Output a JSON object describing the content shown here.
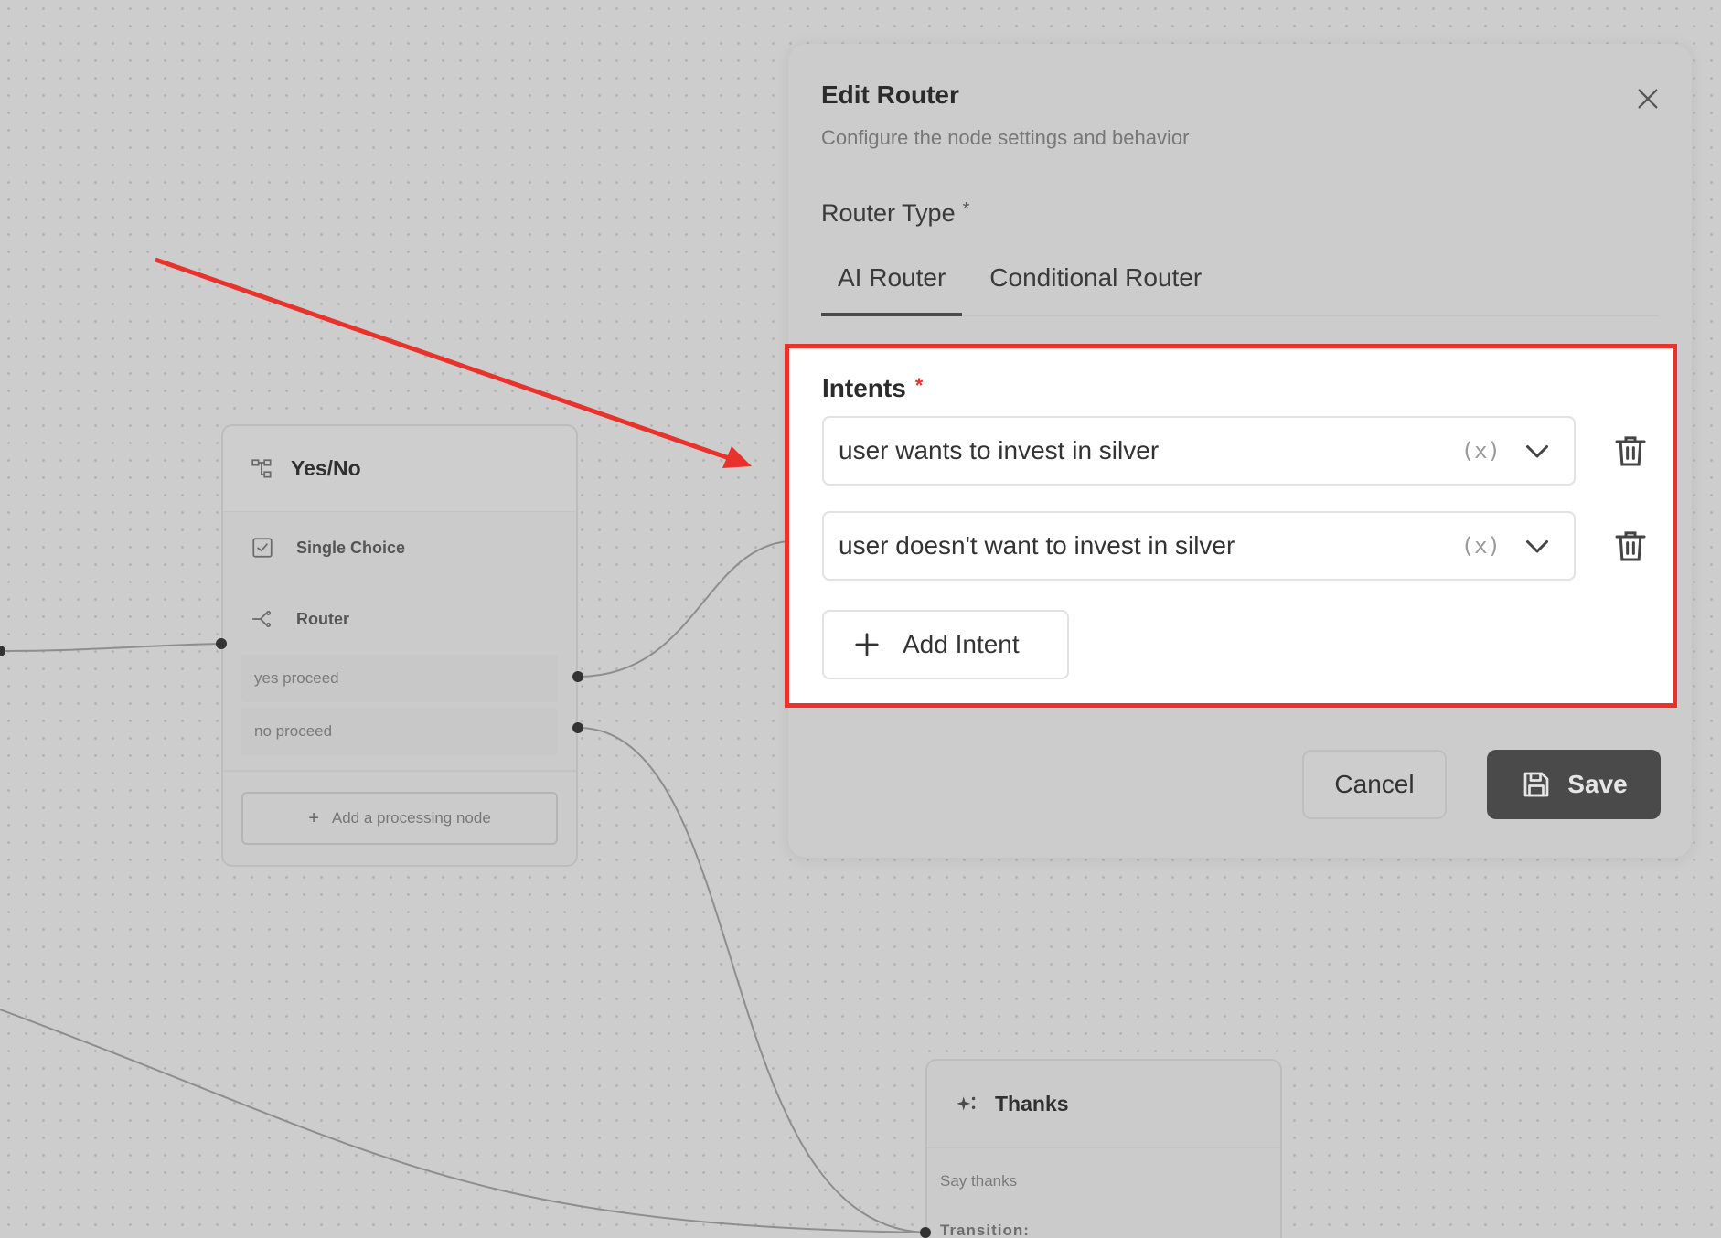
{
  "dialog": {
    "title": "Edit Router",
    "subtitle": "Configure the node settings and behavior",
    "router_type_label": "Router Type",
    "required_mark": "*",
    "tabs": [
      {
        "label": "AI Router",
        "active": true
      },
      {
        "label": "Conditional Router",
        "active": false
      }
    ],
    "intents_label": "Intents",
    "intents": [
      {
        "value": "user wants to invest in silver",
        "var_chip": "(x)"
      },
      {
        "value": "user doesn't want to invest in silver",
        "var_chip": "(x)"
      }
    ],
    "add_intent_label": "Add Intent",
    "cancel_label": "Cancel",
    "save_label": "Save"
  },
  "nodes": {
    "yesno": {
      "title": "Yes/No",
      "items": [
        {
          "label": "Single Choice",
          "icon": "checkbox-icon"
        },
        {
          "label": "Router",
          "icon": "router-icon"
        }
      ],
      "routes": [
        "yes proceed",
        "no proceed"
      ],
      "add_label": "Add a processing node"
    },
    "thanks": {
      "title": "Thanks",
      "icon": "sparkle-icon",
      "lines": [
        "Say thanks",
        "Transition:"
      ]
    }
  },
  "colors": {
    "highlight_border": "#e8322c",
    "annotation_arrow": "#e8322c",
    "save_button_bg": "#4a4a4a"
  }
}
